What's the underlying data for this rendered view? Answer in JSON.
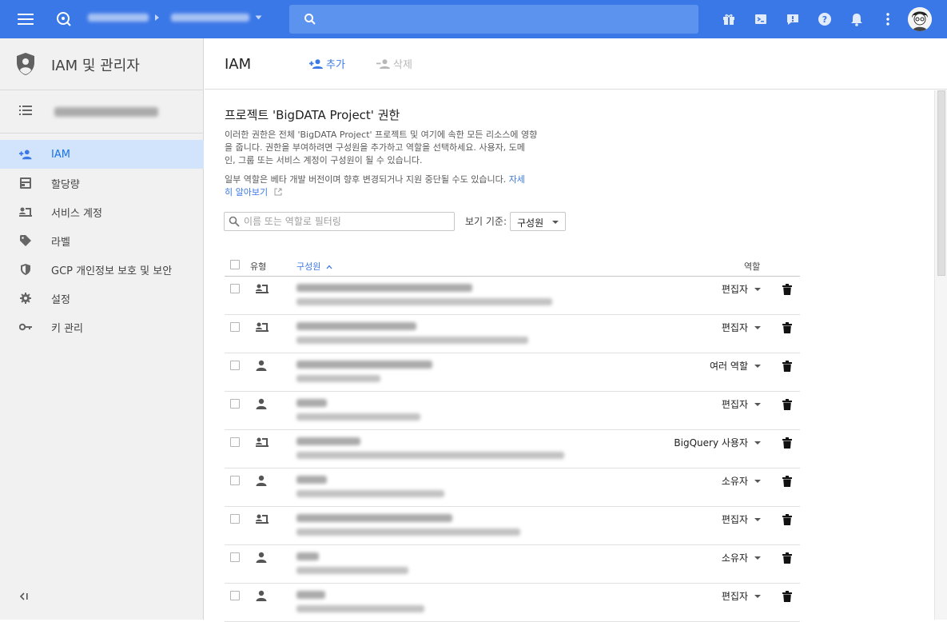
{
  "colors": {
    "topbar": "#3b78e7",
    "accent": "#3b78e7",
    "active_nav_bg": "#d2e3fc"
  },
  "sidebar": {
    "title": "IAM 및 관리자",
    "items": [
      {
        "label": "IAM",
        "icon": "person-add-icon",
        "active": true
      },
      {
        "label": "할당량",
        "icon": "quota-icon",
        "active": false
      },
      {
        "label": "서비스 계정",
        "icon": "service-account-icon",
        "active": false
      },
      {
        "label": "라벨",
        "icon": "label-tag-icon",
        "active": false
      },
      {
        "label": "GCP 개인정보 보호 및 보안",
        "icon": "shield-icon",
        "active": false
      },
      {
        "label": "설정",
        "icon": "gear-icon",
        "active": false
      },
      {
        "label": "키 관리",
        "icon": "key-icon",
        "active": false
      }
    ],
    "collapse_label": "<|"
  },
  "header": {
    "title": "IAM",
    "add_label": "추가",
    "delete_label": "삭제"
  },
  "main": {
    "section_title": "프로젝트 'BigDATA Project' 권한",
    "desc1_line1": "이러한 권한은 전체 'BigDATA Project' 프로젝트 및 여기에 속한 모든 리소스에 영향",
    "desc1_line2": "을 줍니다. 권한을 부여하려면 구성원을 추가하고 역할을 선택하세요. 사용자, 도메",
    "desc1_line3": "인, 그룹 또는 서비스 계정이 구성원이 될 수 있습니다.",
    "desc2_line1_text": "일부 역할은 베타 개발 버전이며 향후 변경되거나 지원 중단될 수도 있습니다. ",
    "desc2_link_part1": "자세",
    "desc2_link_part2": "히 알아보기",
    "filter_placeholder": "이름 또는 역할로 필터링",
    "viewby_label": "보기 기준:",
    "viewby_value": "구성원"
  },
  "table": {
    "col_type": "유형",
    "col_member": "구성원",
    "col_role": "역할",
    "rows": [
      {
        "type": "service-account",
        "role": "편집자"
      },
      {
        "type": "service-account",
        "role": "편집자"
      },
      {
        "type": "person",
        "role": "여러 역할"
      },
      {
        "type": "person",
        "role": "편집자"
      },
      {
        "type": "service-account",
        "role": "BigQuery 사용자"
      },
      {
        "type": "person",
        "role": "소유자"
      },
      {
        "type": "service-account",
        "role": "편집자"
      },
      {
        "type": "person",
        "role": "소유자"
      },
      {
        "type": "person",
        "role": "편집자"
      }
    ]
  }
}
